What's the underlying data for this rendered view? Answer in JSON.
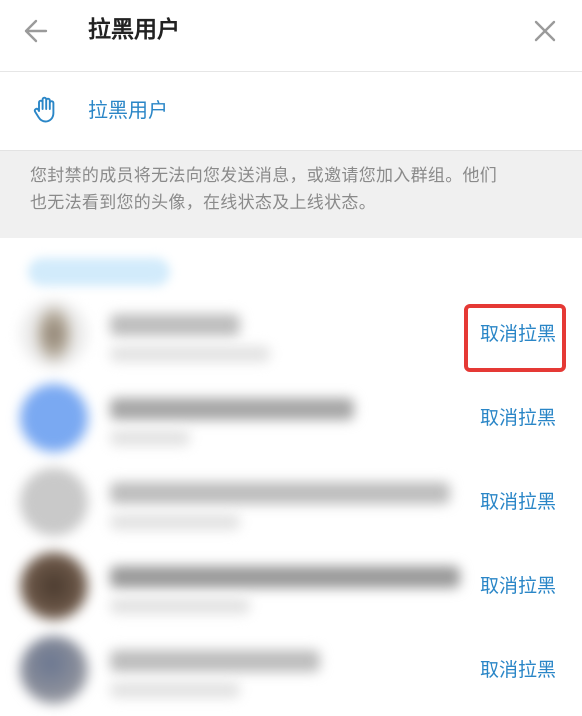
{
  "header": {
    "title": "拉黑用户"
  },
  "block_row": {
    "label": "拉黑用户"
  },
  "info": {
    "line1": "您封禁的成员将无法向您发送消息，或邀请您加入群组。他们",
    "line2": "也无法看到您的头像，在线状态及上线状态。"
  },
  "users": [
    {
      "unblock_label": "取消拉黑"
    },
    {
      "unblock_label": "取消拉黑"
    },
    {
      "unblock_label": "取消拉黑"
    },
    {
      "unblock_label": "取消拉黑"
    },
    {
      "unblock_label": "取消拉黑"
    }
  ],
  "colors": {
    "accent": "#2a86c7",
    "highlight": "#e53935"
  },
  "icons": {
    "back": "arrow-left-icon",
    "close": "close-icon",
    "block": "hand-icon"
  }
}
